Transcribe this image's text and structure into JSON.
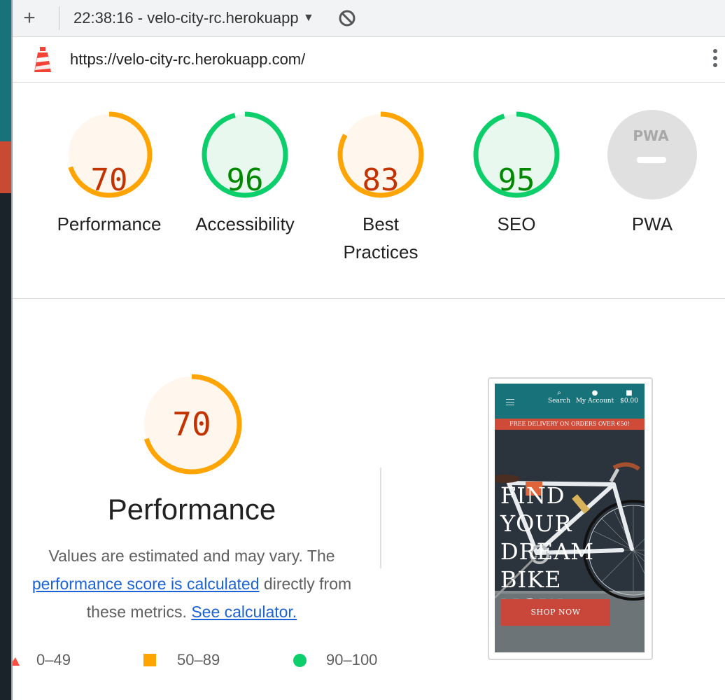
{
  "browser": {
    "new_tab_symbol": "+",
    "tab_title": "22:38:16 - velo-city-rc.herokuapp.com",
    "tab_caret": "▼",
    "url": "https://velo-city-rc.herokuapp.com/"
  },
  "scores": [
    {
      "label": "Performance",
      "value": "70",
      "fraction": 0.7,
      "color": "#ffa400",
      "text_color": "#c33300",
      "fill": "#fff6ed"
    },
    {
      "label": "Accessibility",
      "value": "96",
      "fraction": 0.96,
      "color": "#0cce6b",
      "text_color": "#008800",
      "fill": "#e8f8ef"
    },
    {
      "label": "Best Practices",
      "value": "83",
      "fraction": 0.83,
      "color": "#ffa400",
      "text_color": "#c33300",
      "fill": "#fff6ed"
    },
    {
      "label": "SEO",
      "value": "95",
      "fraction": 0.95,
      "color": "#0cce6b",
      "text_color": "#008800",
      "fill": "#e8f8ef"
    },
    {
      "label": "PWA",
      "value": "PWA",
      "fill": "#e0e0e0"
    }
  ],
  "performance": {
    "score": "70",
    "fraction": 0.7,
    "title": "Performance",
    "desc_prefix": "Values are estimated and may vary. The ",
    "desc_link": "performance score is calculated",
    "desc_middle": " directly from these metrics. ",
    "calculator_link": "See calculator."
  },
  "legend": [
    {
      "range": "0–49",
      "shape": "triangle",
      "color": "#ff4e42"
    },
    {
      "range": "50–89",
      "shape": "square",
      "color": "#ffa400"
    },
    {
      "range": "90–100",
      "shape": "circle",
      "color": "#0cce6b"
    }
  ],
  "thumbnail": {
    "nav": [
      {
        "icon": "search-icon",
        "label": "Search"
      },
      {
        "icon": "account-icon",
        "label": "My Account"
      },
      {
        "icon": "bag-icon",
        "label": "$0.00"
      }
    ],
    "banner": "FREE DELIVERY ON ORDERS OVER €50!",
    "heading": "FIND YOUR DREAM BIKE NOW",
    "button": "SHOP NOW"
  }
}
